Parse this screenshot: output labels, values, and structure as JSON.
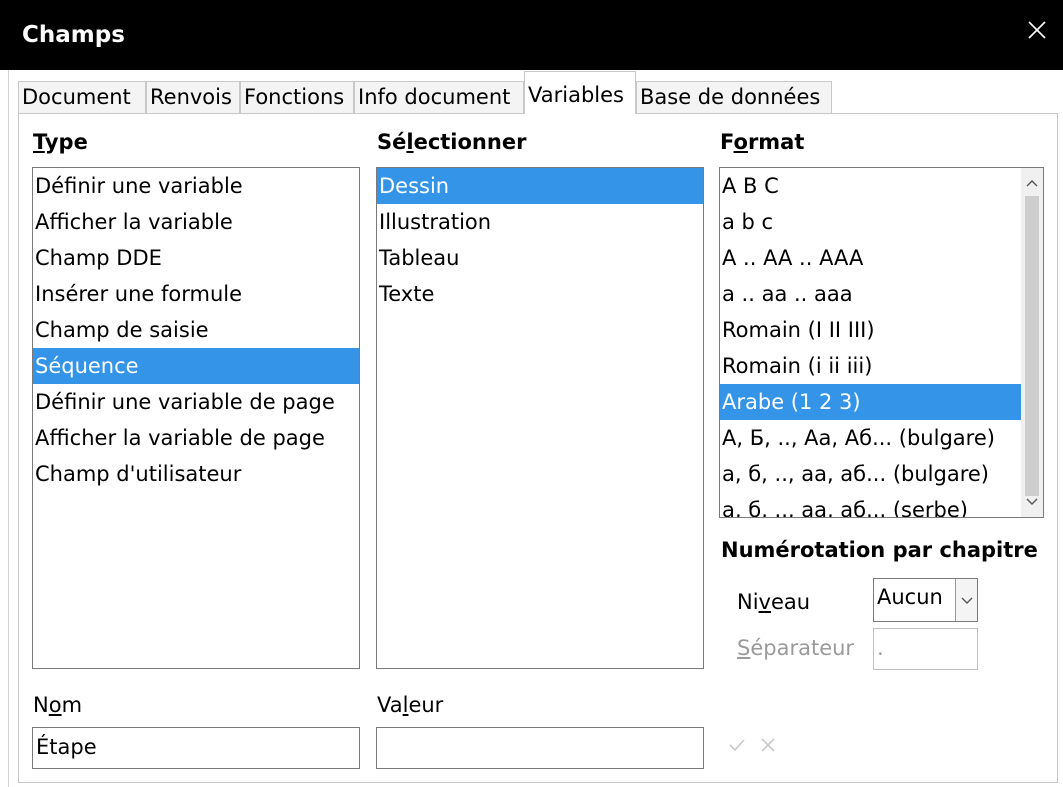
{
  "window": {
    "title": "Champs"
  },
  "tabs": [
    "Document",
    "Renvois",
    "Fonctions",
    "Info document",
    "Variables",
    "Base de données"
  ],
  "type_section": {
    "header_prefix": "",
    "header_underlined": "T",
    "header_rest": "ype",
    "items": [
      "Définir une variable",
      "Afficher la variable",
      "Champ DDE",
      "Insérer une formule",
      "Champ de saisie",
      "Séquence",
      "Définir une variable de page",
      "Afficher la variable de page",
      "Champ d'utilisateur"
    ],
    "selected": "Séquence"
  },
  "select_section": {
    "header_prefix": "Sé",
    "header_underlined": "l",
    "header_rest": "ectionner",
    "items": [
      "Dessin",
      "Illustration",
      "Tableau",
      "Texte"
    ],
    "selected": "Dessin"
  },
  "format_section": {
    "header_prefix": "F",
    "header_underlined": "o",
    "header_rest": "rmat",
    "items": [
      "A B C",
      "a b c",
      "A .. AA .. AAA",
      "a .. aa .. aaa",
      "Romain (I II III)",
      "Romain (i ii iii)",
      "Arabe (1 2 3)",
      "А, Б, .., Аа, Аб... (bulgare)",
      "а, б, .., аа, аб... (bulgare)",
      "а, б, .., аа, аб... (serbe)"
    ],
    "selected": "Arabe (1 2 3)"
  },
  "chapter": {
    "header": "Numérotation par chapitre",
    "level_prefix": "Ni",
    "level_underlined": "v",
    "level_rest": "eau",
    "level_value": "Aucun",
    "separator_underlined": "S",
    "separator_rest": "éparateur",
    "separator_value": "."
  },
  "name": {
    "label_prefix": "N",
    "label_underlined": "o",
    "label_rest": "m",
    "value": "Étape"
  },
  "value": {
    "label_prefix": "Va",
    "label_underlined": "l",
    "label_rest": "eur",
    "value": ""
  },
  "icons": {
    "apply": "check-icon",
    "cancel": "cancel-icon",
    "close": "close-icon"
  },
  "colors": {
    "selection": "#3394e8",
    "titlebar": "#000000"
  }
}
